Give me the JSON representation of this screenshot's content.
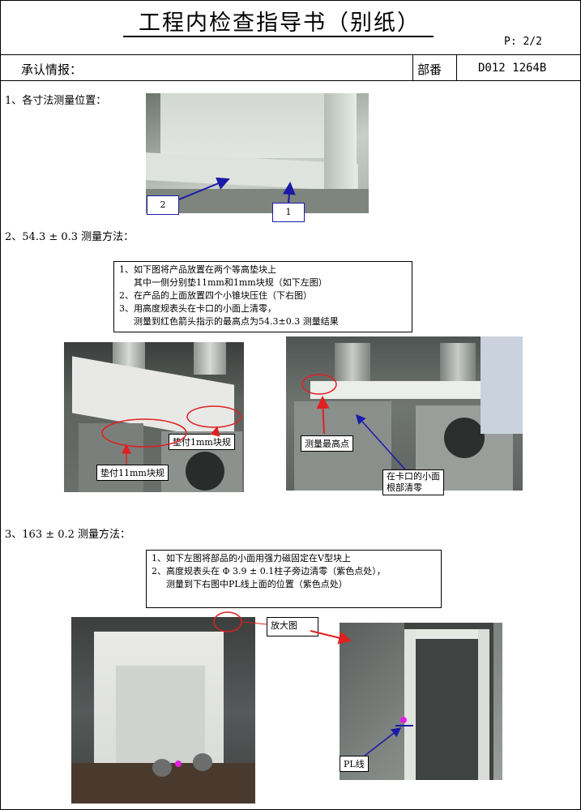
{
  "header": {
    "title": "工程内检查指导书（别纸）",
    "page_no": "P: 2/2",
    "approval_label": "承认情报：",
    "part_label": "部番",
    "part_number": "D012  1264B"
  },
  "section1": {
    "heading": "1、各寸法测量位置：",
    "marker1": "1",
    "marker2": "2"
  },
  "section2": {
    "heading": "2、54.3 ± 0.3 测量方法：",
    "instructions": [
      "1、如下图将产品放置在两个等高垫块上",
      "其中一侧分别垫11mm和1mm块规（如下左图）",
      "2、在产品的上面放置四个小锥块压住（下右图）",
      "3、用高度规表头在卡口的小面上清零，",
      "测量到红色箭头指示的最高点为54.3±0.3 测量结果"
    ],
    "tag_1mm": "垫付1mm块规",
    "tag_11mm": "垫付11mm块规",
    "tag_highest": "测量最高点",
    "tag_zero_line1": "在卡口的小面",
    "tag_zero_line2": "根部清零"
  },
  "section3": {
    "heading": "3、163 ± 0.2 测量方法：",
    "instructions": [
      "1、如下左图将部品的小面用强力磁固定在V型块上",
      "2、高度规表头在 Φ 3.9 ± 0.1柱子旁边清零（紫色点处），",
      "测量到下右图中PL线上面的位置（紫色点处）"
    ],
    "tag_enlarge": "放大图",
    "tag_pl": "PL线"
  },
  "colors": {
    "red_marker": "#e02020",
    "blue_marker": "#1a1aa8",
    "purple_dot": "#e020e0"
  }
}
